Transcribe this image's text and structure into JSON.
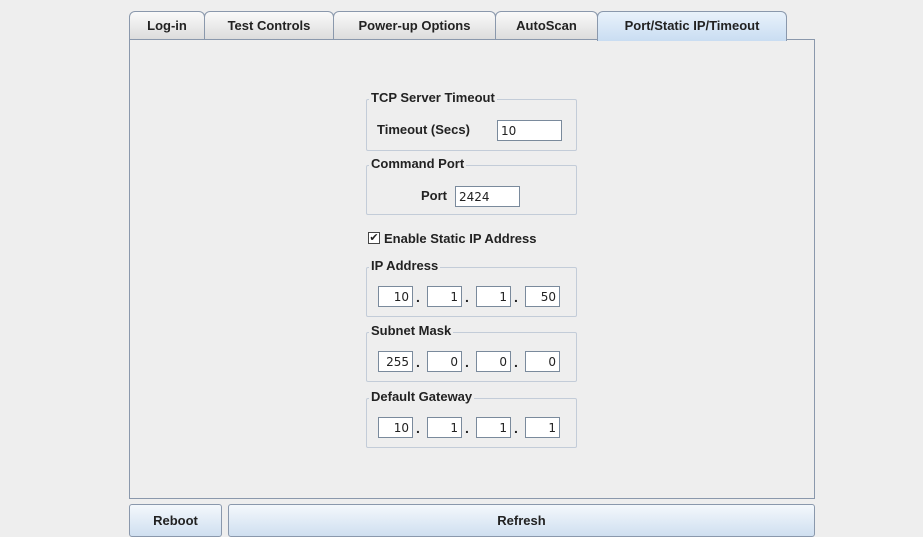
{
  "tabs": [
    {
      "label": "Log-in"
    },
    {
      "label": "Test Controls"
    },
    {
      "label": "Power-up Options"
    },
    {
      "label": "AutoScan"
    },
    {
      "label": "Port/Static IP/Timeout"
    }
  ],
  "tcp_timeout": {
    "title": "TCP Server Timeout",
    "label": "Timeout (Secs)",
    "value": "10"
  },
  "command_port": {
    "title": "Command Port",
    "label": "Port",
    "value": "2424"
  },
  "static_ip": {
    "label": "Enable Static IP Address",
    "checked": true
  },
  "ip_address": {
    "title": "IP Address",
    "octets": [
      "10",
      "1",
      "1",
      "50"
    ]
  },
  "subnet_mask": {
    "title": "Subnet Mask",
    "octets": [
      "255",
      "0",
      "0",
      "0"
    ]
  },
  "default_gateway": {
    "title": "Default Gateway",
    "octets": [
      "10",
      "1",
      "1",
      "1"
    ]
  },
  "buttons": {
    "reboot": "Reboot",
    "refresh": "Refresh"
  }
}
